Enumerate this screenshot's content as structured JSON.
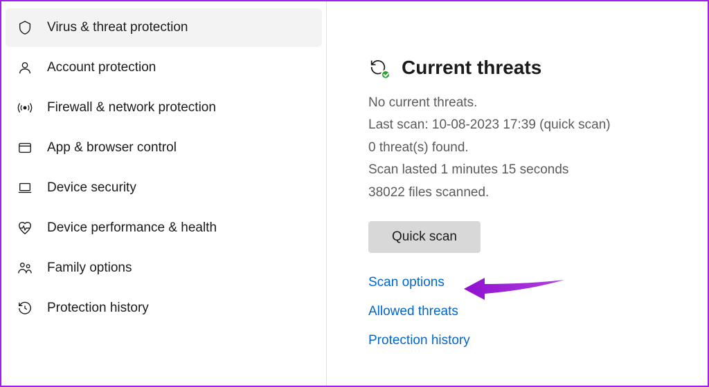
{
  "sidebar": {
    "items": [
      {
        "label": "Virus & threat protection",
        "icon": "shield-icon"
      },
      {
        "label": "Account protection",
        "icon": "person-icon"
      },
      {
        "label": "Firewall & network protection",
        "icon": "radio-icon"
      },
      {
        "label": "App & browser control",
        "icon": "browser-icon"
      },
      {
        "label": "Device security",
        "icon": "laptop-icon"
      },
      {
        "label": "Device performance & health",
        "icon": "heart-icon"
      },
      {
        "label": "Family options",
        "icon": "family-icon"
      },
      {
        "label": "Protection history",
        "icon": "history-icon"
      }
    ]
  },
  "main": {
    "section_title": "Current threats",
    "status": {
      "line1": "No current threats.",
      "line2": "Last scan: 10-08-2023 17:39 (quick scan)",
      "line3": "0 threat(s) found.",
      "line4": "Scan lasted 1 minutes 15 seconds",
      "line5": "38022 files scanned."
    },
    "scan_button": "Quick scan",
    "links": {
      "scan_options": "Scan options",
      "allowed_threats": "Allowed threats",
      "protection_history": "Protection history"
    }
  },
  "annotation": {
    "arrow_color": "#9010d0"
  }
}
